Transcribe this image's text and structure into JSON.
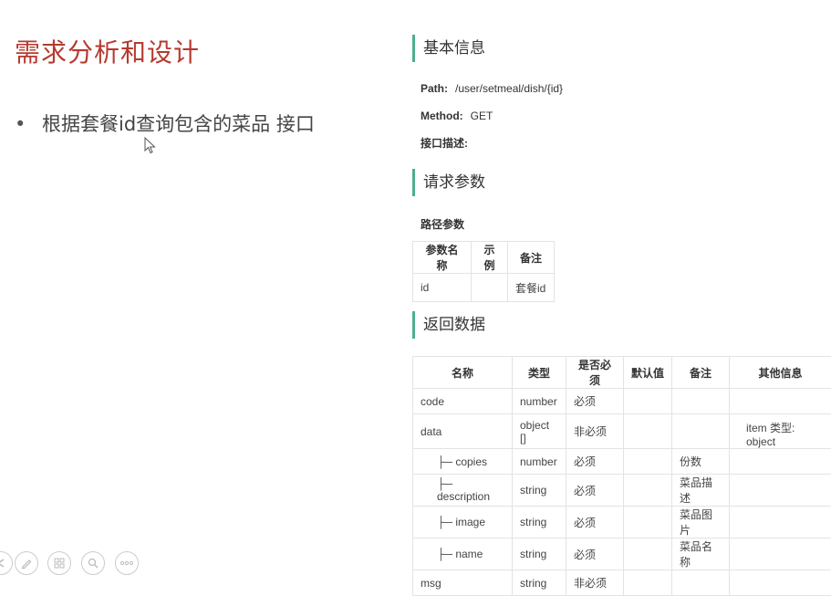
{
  "slide": {
    "title": "需求分析和设计",
    "bullet": "根据套餐id查询包含的菜品 接口",
    "bullet_marker": "•"
  },
  "api": {
    "basic_info_title": "基本信息",
    "path_label": "Path:",
    "path_value": "/user/setmeal/dish/{id}",
    "method_label": "Method:",
    "method_value": "GET",
    "desc_label": "接口描述:",
    "req_title": "请求参数",
    "path_params_title": "路径参数",
    "params_headers": [
      "参数名称",
      "示例",
      "备注"
    ],
    "params_rows": [
      [
        "id",
        "",
        "套餐id"
      ]
    ],
    "resp_title": "返回数据",
    "resp_headers": [
      "名称",
      "类型",
      "是否必须",
      "默认值",
      "备注",
      "其他信息"
    ],
    "resp_rows": [
      [
        "code",
        "number",
        "必须",
        "",
        "",
        ""
      ],
      [
        "data",
        "object []",
        "非必须",
        "",
        "",
        "item 类型: object"
      ],
      [
        "├─ copies",
        "number",
        "必须",
        "",
        "份数",
        ""
      ],
      [
        "├─ description",
        "string",
        "必须",
        "",
        "菜品描述",
        ""
      ],
      [
        "├─ image",
        "string",
        "必须",
        "",
        "菜品图片",
        ""
      ],
      [
        "├─ name",
        "string",
        "必须",
        "",
        "菜品名称",
        ""
      ],
      [
        "msg",
        "string",
        "非必须",
        "",
        "",
        ""
      ]
    ]
  },
  "colors": {
    "title": "#b53a2f",
    "section_bar": "#4caf8f"
  },
  "toolbar_icons": [
    "arrow-icon",
    "pen-icon",
    "slides-icon",
    "zoom-icon",
    "more-icon"
  ]
}
